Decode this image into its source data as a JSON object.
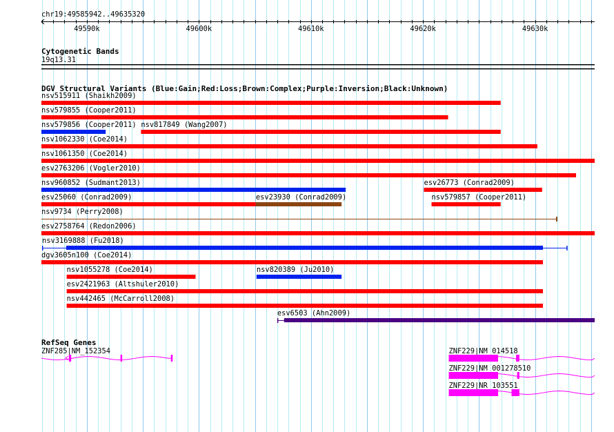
{
  "ruler": {
    "position_label": "chr19:49585942..49635320",
    "start_kb": 49585.942,
    "end_kb": 49635.32,
    "tick_labels": [
      {
        "kb": 49590,
        "label": "49590k"
      },
      {
        "kb": 49600,
        "label": "49600k"
      },
      {
        "kb": 49610,
        "label": "49610k"
      },
      {
        "kb": 49620,
        "label": "49620k"
      },
      {
        "kb": 49630,
        "label": "49630k"
      }
    ]
  },
  "cytoband": {
    "title": "Cytogenetic Bands",
    "band": "19q13.31"
  },
  "dgv": {
    "title": "DGV Structural Variants (Blue:Gain;Red:Loss;Brown:Complex;Purple:Inversion;Black:Unknown)",
    "colors": {
      "gain": "#0022ee",
      "loss": "#ff0000",
      "complex": "#8b4513",
      "inversion": "#4b0082"
    },
    "features": [
      {
        "row": 0,
        "label": "nsv515911 (Shaikh2009)",
        "type": "loss",
        "start": 49585.94,
        "end": 49626.93
      },
      {
        "row": 1,
        "label": "nsv579855 (Cooper2011)",
        "type": "loss",
        "start": 49585.94,
        "end": 49622.24
      },
      {
        "row": 2,
        "label": "nsv579856 (Cooper2011)",
        "type": "gain",
        "start": 49585.94,
        "end": 49591.68
      },
      {
        "row": 2,
        "label": "nsv817849 (Wang2007)",
        "type": "loss",
        "start": 49594.83,
        "end": 49626.93
      },
      {
        "row": 3,
        "label": "nsv1062330 (Coe2014)",
        "type": "loss",
        "start": 49585.94,
        "end": 49630.2
      },
      {
        "row": 4,
        "label": "nsv1061350 (Coe2014)",
        "type": "loss",
        "start": 49585.94,
        "end": 49635.32
      },
      {
        "row": 5,
        "label": "esv2763206 (Vogler2010)",
        "type": "loss",
        "start": 49585.94,
        "end": 49633.66
      },
      {
        "row": 6,
        "label": "nsv960852 (Sudmant2013)",
        "type": "gain",
        "start": 49585.94,
        "end": 49613.1
      },
      {
        "row": 6,
        "label": "esv26773 (Conrad2009)",
        "type": "loss",
        "start": 49620.08,
        "end": 49630.63
      },
      {
        "row": 7,
        "label": "esv25060 (Conrad2009)",
        "type": "loss",
        "start": 49585.94,
        "end": 49605.08
      },
      {
        "row": 7,
        "label": "esv23930 (Conrad2009)",
        "type": "complex",
        "start": 49605.08,
        "end": 49612.73
      },
      {
        "row": 7,
        "label": "nsv579857 (Cooper2011)",
        "type": "loss",
        "start": 49620.76,
        "end": 49626.93
      },
      {
        "row": 8,
        "label": "nsv9734 (Perry2008)",
        "type": "complex",
        "start": 49585.94,
        "end": 49631.93,
        "thin": true
      },
      {
        "row": 9,
        "label": "esv2758764 (Redon2006)",
        "type": "loss",
        "start": 49585.94,
        "end": 49635.32
      },
      {
        "row": 10,
        "label": "nsv3169888 (Fu2018)",
        "type": "gain",
        "start": 49586.0,
        "end": 49632.9,
        "thick_start": 49588.16,
        "thick_end": 49630.7
      },
      {
        "row": 11,
        "label": "dgv3605n100 (Coe2014)",
        "type": "loss",
        "start": 49585.94,
        "end": 49630.7
      },
      {
        "row": 12,
        "label": "nsv1055278 (Coe2014)",
        "type": "loss",
        "start": 49588.2,
        "end": 49599.7
      },
      {
        "row": 12,
        "label": "nsv820389 (Ju2010)",
        "type": "gain",
        "start": 49605.14,
        "end": 49612.73
      },
      {
        "row": 13,
        "label": "esv2421963 (Altshuler2010)",
        "type": "loss",
        "start": 49588.2,
        "end": 49630.7
      },
      {
        "row": 14,
        "label": "nsv442465 (McCarroll2008)",
        "type": "loss",
        "start": 49588.2,
        "end": 49630.7
      },
      {
        "row": 15,
        "label": "esv6503 (Ahn2009)",
        "type": "inversion",
        "start": 49606.99,
        "end": 49635.32,
        "thick_start": 49607.6,
        "thick_end": 49635.32
      }
    ]
  },
  "refseq": {
    "title": "RefSeq Genes",
    "color": "#ff00ff",
    "genes": [
      {
        "label": "ZNF285|NM_152354",
        "start": 49585.94,
        "end": 49597.6,
        "exons": [
          [
            49588.4,
            49588.6
          ],
          [
            49593.0,
            49593.1
          ],
          [
            49597.5,
            49597.6
          ]
        ],
        "strand": "-"
      },
      {
        "label": "ZNF229|NM_014518",
        "start": 49622.3,
        "end": 49635.32,
        "exons": [
          [
            49622.3,
            49626.7
          ],
          [
            49628.3,
            49628.6
          ]
        ],
        "strand": "-"
      },
      {
        "label": "ZNF229|NM_001278510",
        "start": 49622.3,
        "end": 49635.32,
        "exons": [
          [
            49622.3,
            49626.7
          ],
          [
            49628.4,
            49628.6
          ]
        ],
        "strand": "-"
      },
      {
        "label": "ZNF229|NR_103551",
        "start": 49622.3,
        "end": 49635.32,
        "exons": [
          [
            49622.3,
            49626.7
          ],
          [
            49627.9,
            49628.6
          ]
        ],
        "strand": "-"
      }
    ]
  }
}
